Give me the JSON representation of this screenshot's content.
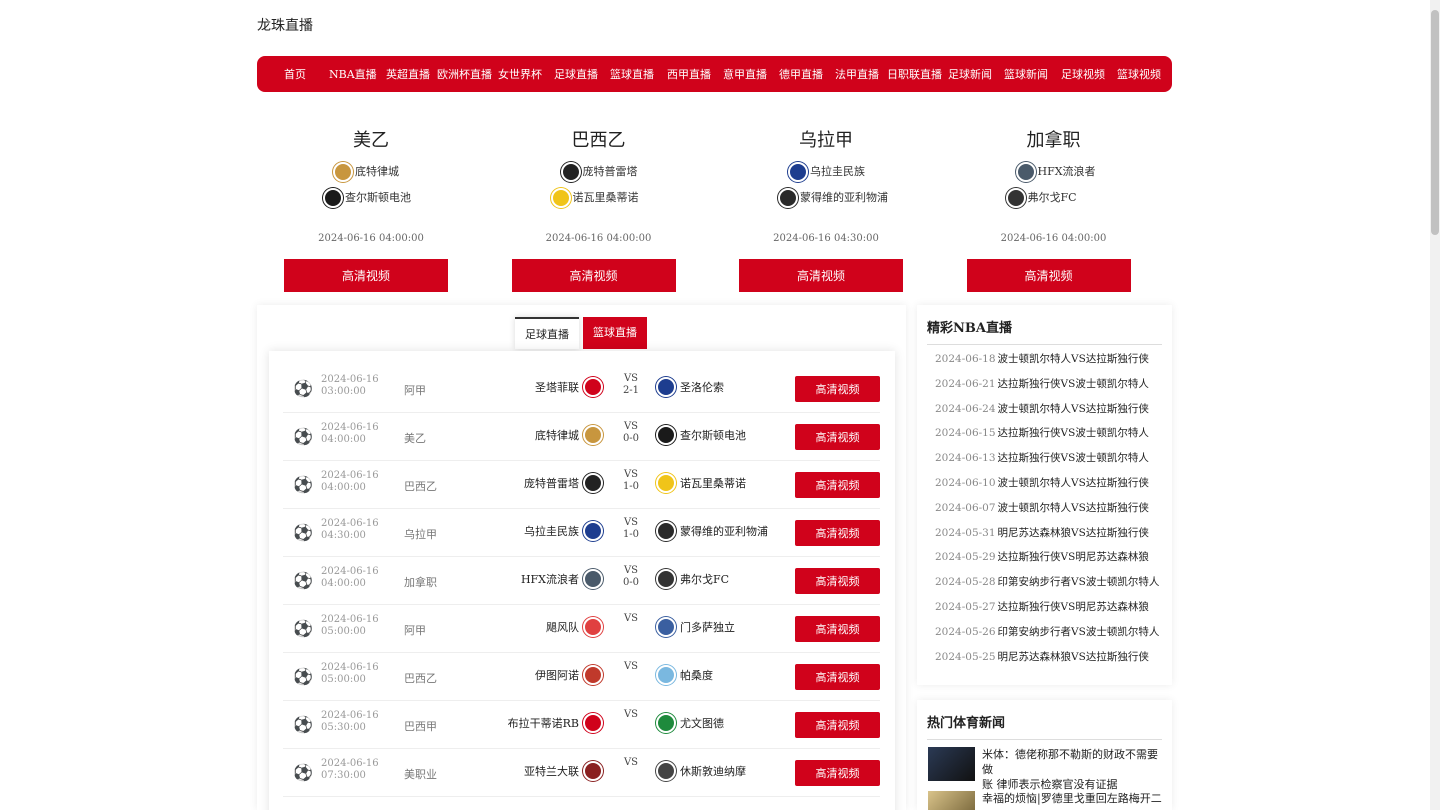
{
  "site": {
    "title": "龙珠直播"
  },
  "nav": [
    "首页",
    "NBA直播",
    "英超直播",
    "欧洲杯直播",
    "女世界杯",
    "足球直播",
    "篮球直播",
    "西甲直播",
    "意甲直播",
    "德甲直播",
    "法甲直播",
    "日职联直播",
    "足球新闻",
    "篮球新闻",
    "足球视频",
    "篮球视频"
  ],
  "featured": [
    {
      "league": "美乙",
      "home": "底特律城",
      "away": "查尔斯顿电池",
      "time": "2024-06-16 04:00:00",
      "button": "高清视频",
      "home_color": "#c8963e",
      "away_color": "#1a1a1a"
    },
    {
      "league": "巴西乙",
      "home": "庞特普雷塔",
      "away": "诺瓦里桑蒂诺",
      "time": "2024-06-16 04:00:00",
      "button": "高清视频",
      "home_color": "#222222",
      "away_color": "#f0c419"
    },
    {
      "league": "乌拉甲",
      "home": "乌拉圭民族",
      "away": "蒙得维的亚利物浦",
      "time": "2024-06-16 04:30:00",
      "button": "高清视频",
      "home_color": "#1d3d8f",
      "away_color": "#2a2a2a"
    },
    {
      "league": "加拿职",
      "home": "HFX流浪者",
      "away": "弗尔戈FC",
      "time": "2024-06-16 04:00:00",
      "button": "高清视频",
      "home_color": "#4a5a6a",
      "away_color": "#333333"
    }
  ],
  "tabs": {
    "football": "足球直播",
    "basketball": "篮球直播"
  },
  "matches": [
    {
      "date": "2024-06-16",
      "time": "03:00:00",
      "league": "阿甲",
      "home": "圣塔菲联",
      "vs": "VS",
      "score": "2-1",
      "away": "圣洛伦索",
      "button": "高清视频",
      "home_color": "#d0021b",
      "away_color": "#1d3d8f"
    },
    {
      "date": "2024-06-16",
      "time": "04:00:00",
      "league": "美乙",
      "home": "底特律城",
      "vs": "VS",
      "score": "0-0",
      "away": "查尔斯顿电池",
      "button": "高清视频",
      "home_color": "#c8963e",
      "away_color": "#1a1a1a"
    },
    {
      "date": "2024-06-16",
      "time": "04:00:00",
      "league": "巴西乙",
      "home": "庞特普雷塔",
      "vs": "VS",
      "score": "1-0",
      "away": "诺瓦里桑蒂诺",
      "button": "高清视频",
      "home_color": "#222222",
      "away_color": "#f0c419"
    },
    {
      "date": "2024-06-16",
      "time": "04:30:00",
      "league": "乌拉甲",
      "home": "乌拉圭民族",
      "vs": "VS",
      "score": "1-0",
      "away": "蒙得维的亚利物浦",
      "button": "高清视频",
      "home_color": "#1d3d8f",
      "away_color": "#2a2a2a"
    },
    {
      "date": "2024-06-16",
      "time": "04:00:00",
      "league": "加拿职",
      "home": "HFX流浪者",
      "vs": "VS",
      "score": "0-0",
      "away": "弗尔戈FC",
      "button": "高清视频",
      "home_color": "#4a5a6a",
      "away_color": "#333333"
    },
    {
      "date": "2024-06-16",
      "time": "05:00:00",
      "league": "阿甲",
      "home": "飓风队",
      "vs": "VS",
      "score": "",
      "away": "门多萨独立",
      "button": "高清视频",
      "home_color": "#e04040",
      "away_color": "#3a5fa0"
    },
    {
      "date": "2024-06-16",
      "time": "05:00:00",
      "league": "巴西乙",
      "home": "伊图阿诺",
      "vs": "VS",
      "score": "",
      "away": "帕桑度",
      "button": "高清视频",
      "home_color": "#c0392b",
      "away_color": "#7ab8e0"
    },
    {
      "date": "2024-06-16",
      "time": "05:30:00",
      "league": "巴西甲",
      "home": "布拉干蒂诺RB",
      "vs": "VS",
      "score": "",
      "away": "尤文图德",
      "button": "高清视频",
      "home_color": "#d0021b",
      "away_color": "#1e8a3c"
    },
    {
      "date": "2024-06-16",
      "time": "07:30:00",
      "league": "美职业",
      "home": "亚特兰大联",
      "vs": "VS",
      "score": "",
      "away": "休斯敦迪纳摩",
      "button": "高清视频",
      "home_color": "#8a2020",
      "away_color": "#444444"
    }
  ],
  "nba": {
    "title": "精彩NBA直播",
    "items": [
      {
        "date": "2024-06-18",
        "text": "波士顿凯尔特人VS达拉斯独行侠"
      },
      {
        "date": "2024-06-21",
        "text": "达拉斯独行侠VS波士顿凯尔特人"
      },
      {
        "date": "2024-06-24",
        "text": "波士顿凯尔特人VS达拉斯独行侠"
      },
      {
        "date": "2024-06-15",
        "text": "达拉斯独行侠VS波士顿凯尔特人"
      },
      {
        "date": "2024-06-13",
        "text": "达拉斯独行侠VS波士顿凯尔特人"
      },
      {
        "date": "2024-06-10",
        "text": "波士顿凯尔特人VS达拉斯独行侠"
      },
      {
        "date": "2024-06-07",
        "text": "波士顿凯尔特人VS达拉斯独行侠"
      },
      {
        "date": "2024-05-31",
        "text": "明尼苏达森林狼VS达拉斯独行侠"
      },
      {
        "date": "2024-05-29",
        "text": "达拉斯独行侠VS明尼苏达森林狼"
      },
      {
        "date": "2024-05-28",
        "text": "印第安纳步行者VS波士顿凯尔特人"
      },
      {
        "date": "2024-05-27",
        "text": "达拉斯独行侠VS明尼苏达森林狼"
      },
      {
        "date": "2024-05-26",
        "text": "印第安纳步行者VS波士顿凯尔特人"
      },
      {
        "date": "2024-05-25",
        "text": "明尼苏达森林狼VS达拉斯独行侠"
      }
    ]
  },
  "news": {
    "title": "热门体育新闻",
    "items": [
      {
        "line1": "米体：德佬称那不勒斯的财政不需要做",
        "line2": "账 律师表示检察官没有证据"
      },
      {
        "line1": "幸福的烦恼|罗德里戈重回左路梅开二",
        "line2": ""
      }
    ]
  }
}
